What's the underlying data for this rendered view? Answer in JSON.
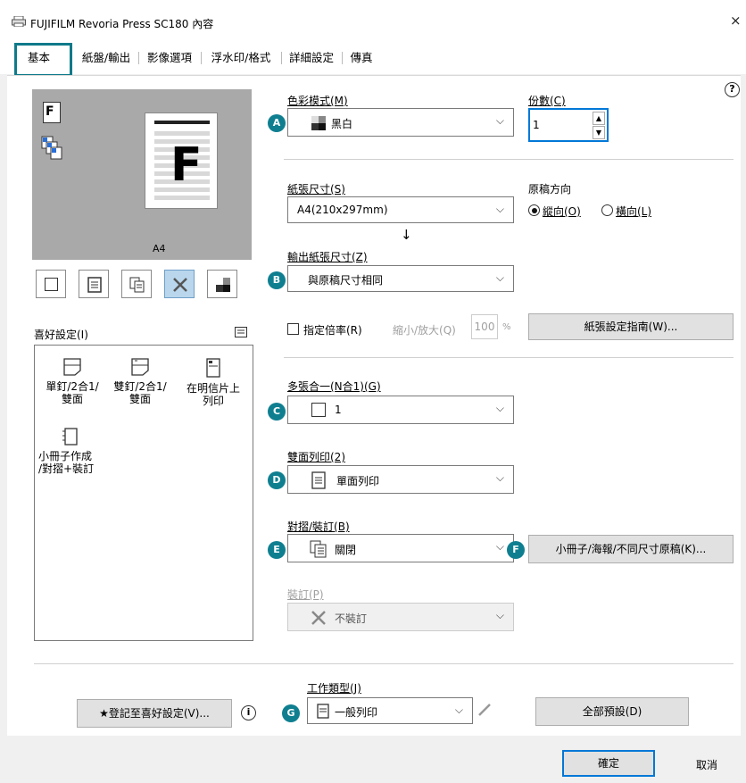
{
  "window": {
    "title": "FUJIFILM Revoria Press SC180 內容",
    "close": "×"
  },
  "tabs": [
    {
      "label": "基本"
    },
    {
      "label": "紙盤/輸出"
    },
    {
      "label": "影像選項"
    },
    {
      "label": "浮水印/格式"
    },
    {
      "label": "詳細設定"
    },
    {
      "label": "傳真"
    }
  ],
  "help": "?",
  "preview": {
    "paper_letter": "F",
    "paper_size": "A4",
    "icon_letter": "F"
  },
  "favorites": {
    "label": "喜好設定(I)",
    "items": [
      {
        "label": "單釘/2合1/\n雙面"
      },
      {
        "label": "雙釘/2合1/\n雙面"
      },
      {
        "label": "在明信片上\n列印"
      },
      {
        "label": "小冊子作成\n/對摺+裝訂"
      }
    ]
  },
  "color_mode": {
    "label": "色彩模式(M)",
    "value": "黑白",
    "badge": "A"
  },
  "copies": {
    "label": "份數(C)",
    "value": "1"
  },
  "paper_size": {
    "label": "紙張尺寸(S)",
    "value": "A4(210x297mm)"
  },
  "orientation": {
    "label": "原稿方向",
    "portrait": "縱向(O)",
    "landscape": "橫向(L)",
    "selected": "portrait"
  },
  "arrow": "↓",
  "output_size": {
    "label": "輸出紙張尺寸(Z)",
    "value": "與原稿尺寸相同",
    "badge": "B"
  },
  "scale": {
    "checkbox": "指定倍率(R)",
    "label": "縮小/放大(Q)",
    "value": "100",
    "unit": "%"
  },
  "paper_guide_button": "紙張設定指南(W)...",
  "nup": {
    "label": "多張合一(N合1)(G)",
    "value": "1",
    "badge": "C"
  },
  "duplex": {
    "label": "雙面列印(2)",
    "value": "單面列印",
    "badge": "D"
  },
  "fold": {
    "label": "對摺/裝訂(B)",
    "value": "關閉",
    "badge": "E"
  },
  "booklet_button": {
    "label": "小冊子/海報/不同尺寸原稿(K)...",
    "badge": "F"
  },
  "staple": {
    "label": "裝訂(P)",
    "value": "不裝訂"
  },
  "job_type": {
    "label": "工作類型(J)",
    "value": "一般列印",
    "badge": "G"
  },
  "register_button": "登記至喜好設定(V)...",
  "info_icon": "i",
  "default_button": "全部預設(D)",
  "ok_button": "確定",
  "cancel_button": "取消",
  "colors": {
    "accent": "#0f7f90",
    "selected_view": "#b9d6ec"
  }
}
